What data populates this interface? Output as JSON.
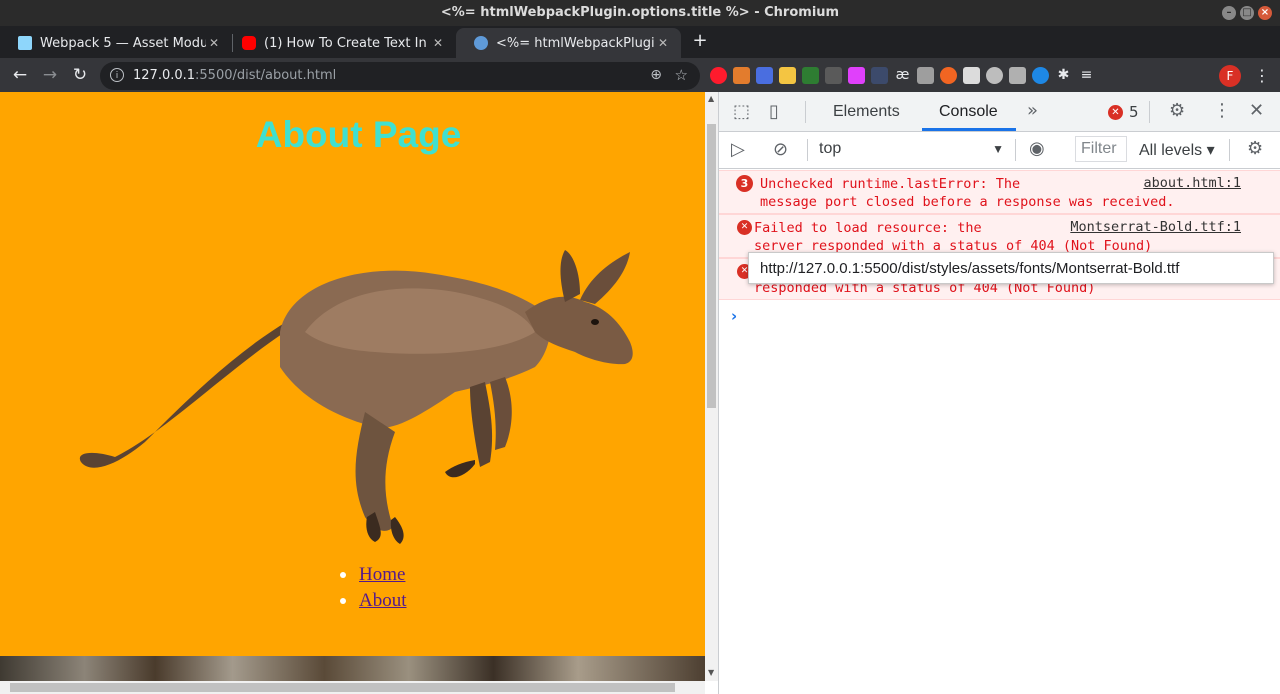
{
  "window": {
    "title": "<%= htmlWebpackPlugin.options.title %> - Chromium"
  },
  "tabs": [
    {
      "label": "Webpack 5 — Asset Modu",
      "favicon_color": "#8ed6fb"
    },
    {
      "label": "(1) How To Create Text In",
      "favicon_color": "#ff0000"
    },
    {
      "label": "<%= htmlWebpackPlugin.",
      "favicon_color": "#5f9ad8"
    }
  ],
  "toolbar": {
    "url_host": "127.0.0.1",
    "url_path": ":5500/dist/about.html",
    "profile_initial": "F"
  },
  "page": {
    "heading": "About Page",
    "nav_links": [
      "Home",
      "About"
    ]
  },
  "devtools": {
    "tabs": [
      "Elements",
      "Console"
    ],
    "error_count": "5",
    "context": "top",
    "filter_placeholder": "Filter",
    "levels": "All levels",
    "messages": [
      {
        "count": "3",
        "text": "Unchecked runtime.lastError: The\nmessage port closed before a response was received.",
        "source": "about.html:1"
      },
      {
        "text": "Failed to load resource: the\nserver responded with a status of 404 (Not Found)",
        "source": "Montserrat-Bold.ttf:1"
      },
      {
        "text": "responded with a status of 404 (Not Found)"
      }
    ],
    "tooltip": "http://127.0.0.1:5500/dist/styles/assets/fonts/Montserrat-Bold.ttf"
  }
}
